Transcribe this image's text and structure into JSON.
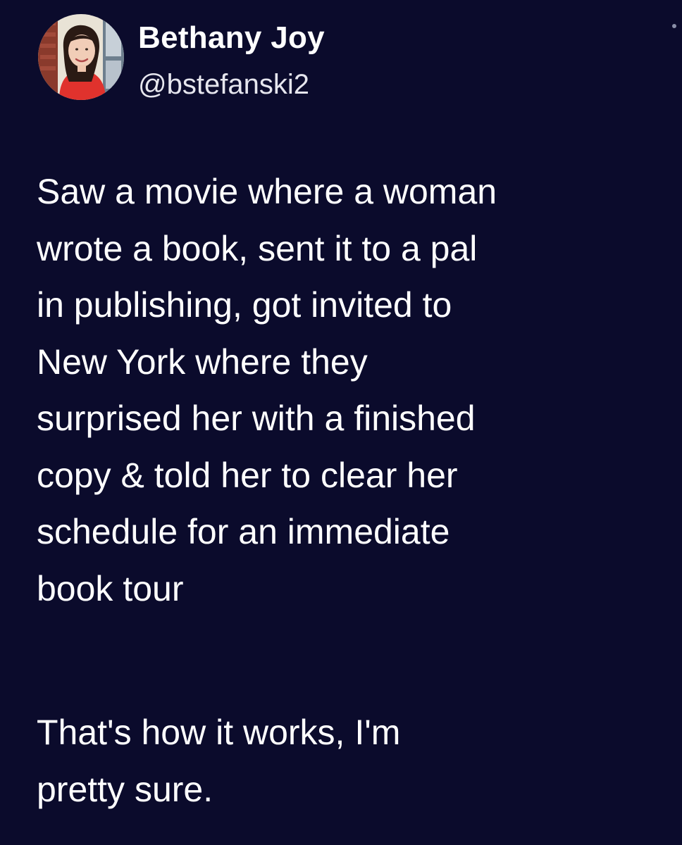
{
  "author": {
    "display_name": "Bethany Joy",
    "handle": "@bstefanski2",
    "avatar_icon": "profile-photo"
  },
  "tweet": {
    "paragraph_1": "Saw a movie where a woman\nwrote a book, sent it to a pal\nin publishing, got invited to\nNew York where they\nsurprised her with a finished\ncopy & told her to clear her\nschedule for an immediate\nbook tour",
    "paragraph_2": "That's how it works, I'm\npretty sure."
  },
  "colors": {
    "background": "#0b0b2c",
    "text": "#ffffff",
    "handle": "#e6e6ee"
  }
}
